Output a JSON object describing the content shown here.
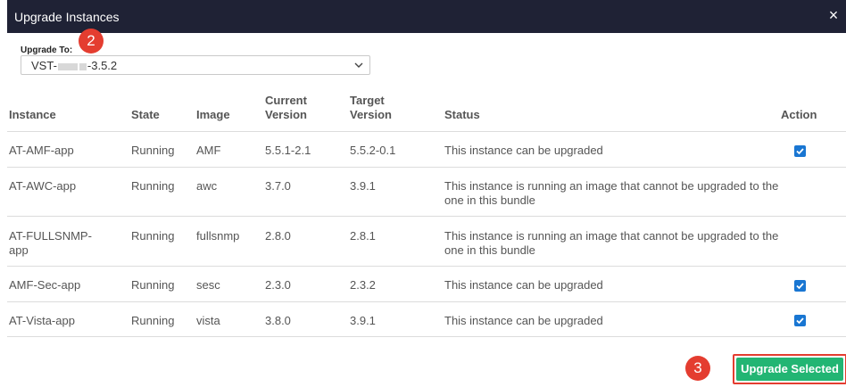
{
  "dialog": {
    "title": "Upgrade Instances",
    "close_glyph": "×"
  },
  "badges": {
    "step2": "2",
    "step3": "3"
  },
  "upgrade_to": {
    "label": "Upgrade To:",
    "value_prefix": "VST-",
    "value_suffix": "-3.5.2"
  },
  "table": {
    "headers": {
      "instance": "Instance",
      "state": "State",
      "image": "Image",
      "current_line1": "Current",
      "current_line2": "Version",
      "target_line1": "Target",
      "target_line2": "Version",
      "status": "Status",
      "action": "Action"
    },
    "rows": [
      {
        "instance_line1": "AT-AMF-app",
        "instance_line2": "",
        "state": "Running",
        "image": "AMF",
        "current": "5.5.1-2.1",
        "target": "5.5.2-0.1",
        "status_line1": "This instance can be upgraded",
        "status_line2": "",
        "checked": true
      },
      {
        "instance_line1": "AT-AWC-app",
        "instance_line2": "",
        "state": "Running",
        "image": "awc",
        "current": "3.7.0",
        "target": "3.9.1",
        "status_line1": "This instance is running an image that cannot be upgraded to the",
        "status_line2": "one in this bundle",
        "checked": false
      },
      {
        "instance_line1": "AT-FULLSNMP-",
        "instance_line2": "app",
        "state": "Running",
        "image": "fullsnmp",
        "current": "2.8.0",
        "target": "2.8.1",
        "status_line1": "This instance is running an image that cannot be upgraded to the",
        "status_line2": "one in this bundle",
        "checked": false
      },
      {
        "instance_line1": "AMF-Sec-app",
        "instance_line2": "",
        "state": "Running",
        "image": "sesc",
        "current": "2.3.0",
        "target": "2.3.2",
        "status_line1": "This instance can be upgraded",
        "status_line2": "",
        "checked": true
      },
      {
        "instance_line1": "AT-Vista-app",
        "instance_line2": "",
        "state": "Running",
        "image": "vista",
        "current": "3.8.0",
        "target": "3.9.1",
        "status_line1": "This instance can be upgraded",
        "status_line2": "",
        "checked": true
      }
    ]
  },
  "footer": {
    "upgrade_button": "Upgrade Selected"
  },
  "colors": {
    "titlebar": "#1f2235",
    "badge": "#e43d30",
    "button": "#22b573",
    "checkbox": "#1976d2",
    "highlight_border": "#e43d30"
  },
  "icons": {
    "close": "close-icon",
    "dropdown": "chevron-down-icon",
    "checkbox": "checkmark-icon"
  }
}
